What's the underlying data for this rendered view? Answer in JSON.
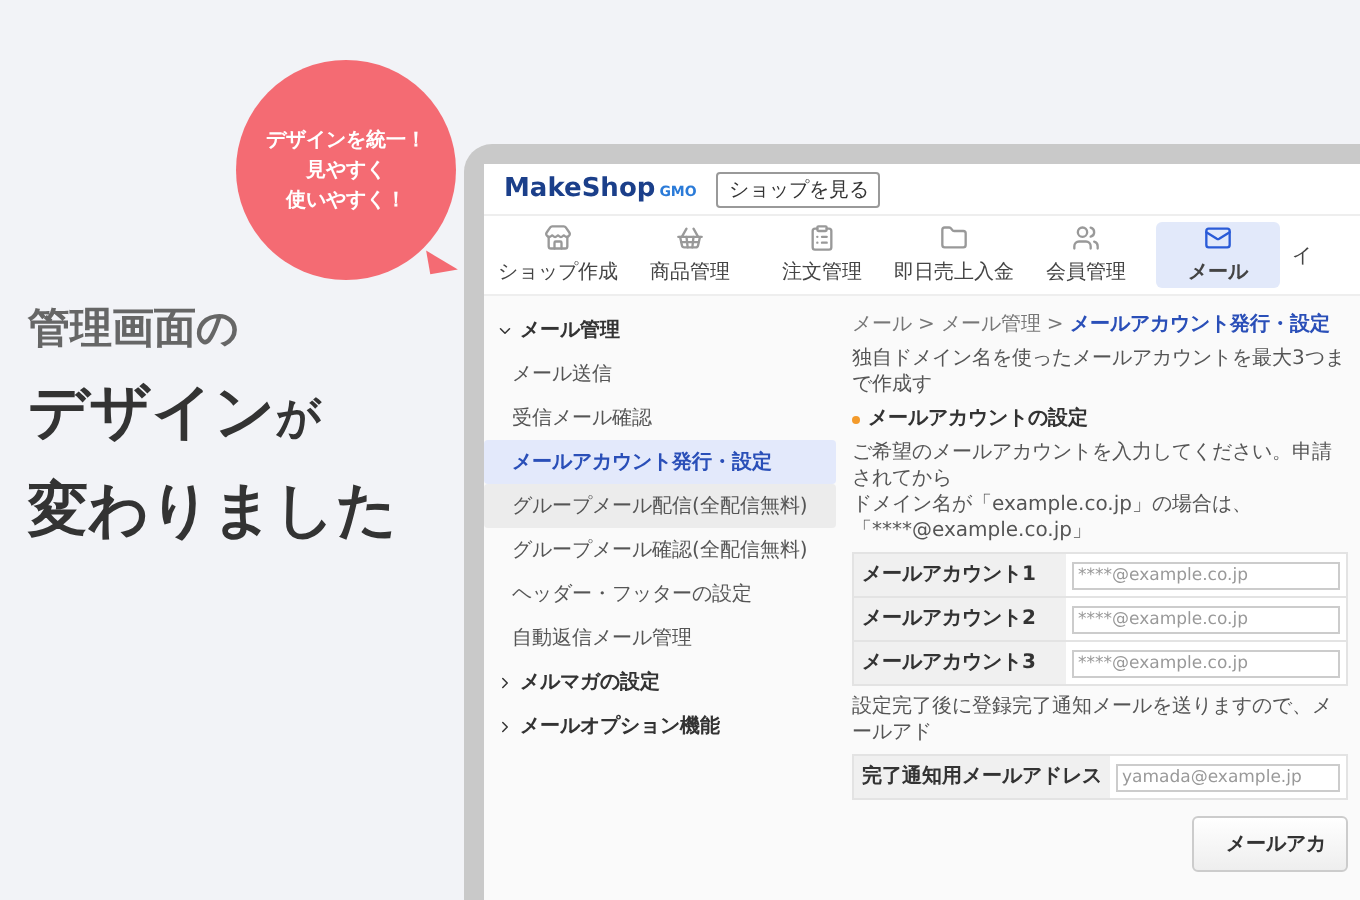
{
  "bubble": {
    "lines": [
      "デザインを統一！",
      "見やすく",
      "使いやすく！"
    ]
  },
  "headline": {
    "line1": "管理画面の",
    "line2": "デザイン",
    "particle": "が",
    "line3": "変わりました"
  },
  "app": {
    "logo": {
      "brand": "MakeShop",
      "suffix": "GMO"
    },
    "view_shop_button": "ショップを見る",
    "nav": [
      {
        "label": "ショップ作成",
        "selected": false
      },
      {
        "label": "商品管理",
        "selected": false
      },
      {
        "label": "注文管理",
        "selected": false
      },
      {
        "label": "即日売上入金",
        "selected": false
      },
      {
        "label": "会員管理",
        "selected": false
      },
      {
        "label": "メール",
        "selected": true
      },
      {
        "label": "イ",
        "selected": false
      }
    ],
    "sidebar": [
      {
        "label": "メール管理",
        "expanded": true,
        "children": [
          {
            "label": "メール送信",
            "selected": false,
            "hovered": false
          },
          {
            "label": "受信メール確認",
            "selected": false,
            "hovered": false
          },
          {
            "label": "メールアカウント発行・設定",
            "selected": true,
            "hovered": false
          },
          {
            "label": "グループメール配信(全配信無料)",
            "selected": false,
            "hovered": true
          },
          {
            "label": "グループメール確認(全配信無料)",
            "selected": false,
            "hovered": false
          },
          {
            "label": "ヘッダー・フッターの設定",
            "selected": false,
            "hovered": false
          },
          {
            "label": "自動返信メール管理",
            "selected": false,
            "hovered": false
          }
        ]
      },
      {
        "label": "メルマガの設定",
        "expanded": false
      },
      {
        "label": "メールオプション機能",
        "expanded": false
      }
    ],
    "breadcrumb": {
      "separator": ">",
      "items": [
        "メール",
        "メール管理",
        "メールアカウント発行・設定"
      ]
    },
    "intro": "独自ドメイン名を使ったメールアカウントを最大3つまで作成す",
    "section_title": "メールアカウントの設定",
    "description": [
      "ご希望のメールアカウントを入力してください。申請されてから",
      "ドメイン名が「example.co.jp」の場合は、「****@example.co.jp」"
    ],
    "accounts": [
      {
        "label": "メールアカウント1",
        "placeholder": "****@example.co.jp"
      },
      {
        "label": "メールアカウント2",
        "placeholder": "****@example.co.jp"
      },
      {
        "label": "メールアカウント3",
        "placeholder": "****@example.co.jp"
      }
    ],
    "note": "設定完了後に登録完了通知メールを送りますので、メールアド",
    "notify": {
      "label": "完了通知用メールアドレス",
      "placeholder": "yamada@example.jp"
    },
    "submit_button": "メールアカ"
  }
}
